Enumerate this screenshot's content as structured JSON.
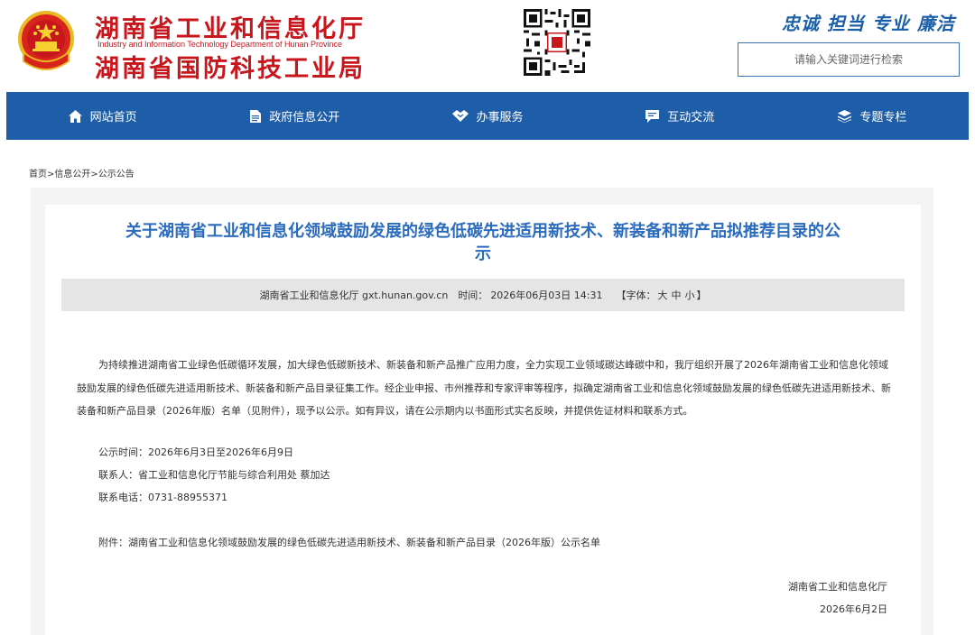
{
  "header": {
    "org_name_1": "湖南省工业和信息化厅",
    "org_name_en": "Industry and Information Technology Department of Hunan Province",
    "org_name_2": "湖南省国防科技工业局",
    "emblem_icon": "national-emblem-icon",
    "qr_icon": "qrcode-icon",
    "slogan": [
      "忠诚",
      "担当",
      "专业",
      "廉洁"
    ],
    "search_placeholder": "请输入关键词进行检索",
    "colors": {
      "red": "#c8161d",
      "blue": "#1e5ea8"
    }
  },
  "nav": [
    {
      "label": "网站首页",
      "icon": "home-icon"
    },
    {
      "label": "政府信息公开",
      "icon": "document-icon"
    },
    {
      "label": "办事服务",
      "icon": "handshake-icon"
    },
    {
      "label": "互动交流",
      "icon": "chat-icon"
    },
    {
      "label": "专题专栏",
      "icon": "layers-icon"
    }
  ],
  "breadcrumb": {
    "home": "首页",
    "sep": ">",
    "info": "信息公开",
    "notice": "公示公告"
  },
  "article": {
    "title_line1": "关于湖南省工业和信息化领域鼓励发展的绿色低碳先进适用新技术、新装备和新产品拟推荐目录的公",
    "title_line2": "示",
    "meta": {
      "source": "湖南省工业和信息化厅 gxt.hunan.gov.cn",
      "time_label": "时间：",
      "time": "2026年06月03日 14:31",
      "font_open": "【字体：",
      "font_large": "大",
      "font_medium": "中",
      "font_small": "小",
      "font_close": "】"
    },
    "paragraph": "为持续推进湖南省工业绿色低碳循环发展，加大绿色低碳新技术、新装备和新产品推广应用力度，全力实现工业领域碳达峰碳中和，我厅组织开展了2026年湖南省工业和信息化领域鼓励发展的绿色低碳先进适用新技术、新装备和新产品目录征集工作。经企业申报、市州推荐和专家评审等程序，拟确定湖南省工业和信息化领域鼓励发展的绿色低碳先进适用新技术、新装备和新产品目录（2026年版）名单（见附件），现予以公示。如有异议，请在公示期内以书面形式实名反映，并提供佐证材料和联系方式。",
    "period": "公示时间：2026年6月3日至2026年6月9日",
    "contact": "联系人：省工业和信息化厅节能与综合利用处  蔡加达",
    "phone": "联系电话：0731-88955371",
    "attachment": "附件：湖南省工业和信息化领域鼓励发展的绿色低碳先进适用新技术、新装备和新产品目录（2026年版）公示名单",
    "signature": "湖南省工业和信息化厅",
    "date": "2026年6月2日"
  }
}
